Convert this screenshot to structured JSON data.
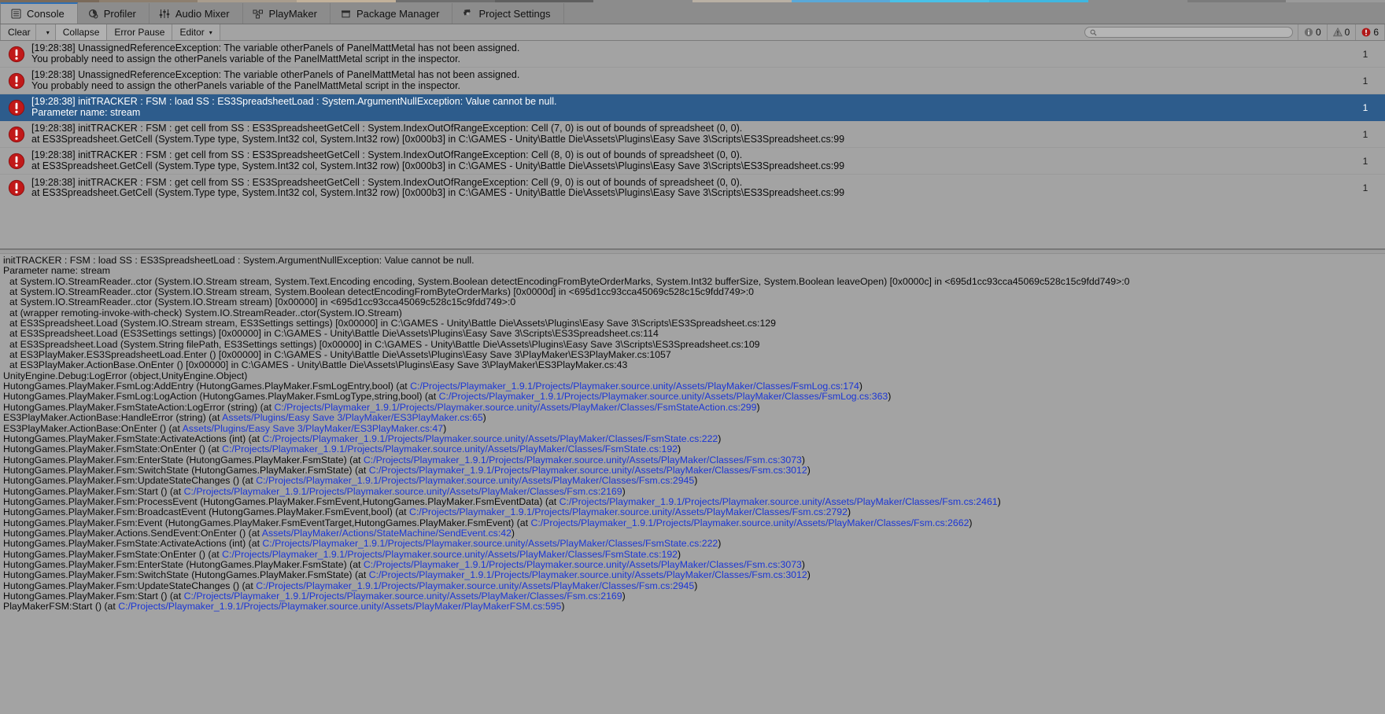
{
  "window": {
    "title": "Unity Console",
    "accent_blue": "#2d5c8c",
    "link_blue": "#1b36d6",
    "error_red": "#c11919",
    "panel_gray": "#a3a3a3"
  },
  "tabs": [
    {
      "label": "Console",
      "icon": "console-icon",
      "active": true
    },
    {
      "label": "Profiler",
      "icon": "profiler-icon",
      "active": false
    },
    {
      "label": "Audio Mixer",
      "icon": "audio-mixer-icon",
      "active": false
    },
    {
      "label": "PlayMaker",
      "icon": "playmaker-icon",
      "active": false
    },
    {
      "label": "Package Manager",
      "icon": "package-manager-icon",
      "active": false
    },
    {
      "label": "Project Settings",
      "icon": "gear-icon",
      "active": false
    }
  ],
  "toolbar": {
    "clear_label": "Clear",
    "clear_caret": "▾",
    "collapse_label": "Collapse",
    "error_pause_label": "Error Pause",
    "editor_label": "Editor",
    "editor_caret": "▾",
    "search_value": "",
    "search_placeholder": "",
    "search_icon": "search-icon",
    "counters": {
      "info_count": "0",
      "warning_count": "0",
      "error_count": "6"
    }
  },
  "log_entries": [
    {
      "icon": "error-icon",
      "line1": "[19:28:38] UnassignedReferenceException: The variable otherPanels of PanelMattMetal has not been assigned.",
      "line2": "You probably need to assign the otherPanels variable of the PanelMattMetal script in the inspector.",
      "count": "1",
      "selected": false
    },
    {
      "icon": "error-icon",
      "line1": "[19:28:38] UnassignedReferenceException: The variable otherPanels of PanelMattMetal has not been assigned.",
      "line2": "You probably need to assign the otherPanels variable of the PanelMattMetal script in the inspector.",
      "count": "1",
      "selected": false
    },
    {
      "icon": "error-icon",
      "line1": "[19:28:38] initTRACKER : FSM : load SS : ES3SpreadsheetLoad : System.ArgumentNullException: Value cannot be null.",
      "line2": "Parameter name: stream",
      "count": "1",
      "selected": true
    },
    {
      "icon": "error-icon",
      "line1": "[19:28:38] initTRACKER : FSM : get cell from SS : ES3SpreadsheetGetCell : System.IndexOutOfRangeException: Cell (7, 0) is out of bounds of spreadsheet (0, 0).",
      "line2": "  at ES3Spreadsheet.GetCell (System.Type type, System.Int32 col, System.Int32 row) [0x000b3] in C:\\GAMES - Unity\\Battle Die\\Assets\\Plugins\\Easy Save 3\\Scripts\\ES3Spreadsheet.cs:99",
      "count": "1",
      "selected": false
    },
    {
      "icon": "error-icon",
      "line1": "[19:28:38] initTRACKER : FSM : get cell from SS : ES3SpreadsheetGetCell : System.IndexOutOfRangeException: Cell (8, 0) is out of bounds of spreadsheet (0, 0).",
      "line2": "  at ES3Spreadsheet.GetCell (System.Type type, System.Int32 col, System.Int32 row) [0x000b3] in C:\\GAMES - Unity\\Battle Die\\Assets\\Plugins\\Easy Save 3\\Scripts\\ES3Spreadsheet.cs:99",
      "count": "1",
      "selected": false
    },
    {
      "icon": "error-icon",
      "line1": "[19:28:38] initTRACKER : FSM : get cell from SS : ES3SpreadsheetGetCell : System.IndexOutOfRangeException: Cell (9, 0) is out of bounds of spreadsheet (0, 0).",
      "line2": "  at ES3Spreadsheet.GetCell (System.Type type, System.Int32 col, System.Int32 row) [0x000b3] in C:\\GAMES - Unity\\Battle Die\\Assets\\Plugins\\Easy Save 3\\Scripts\\ES3Spreadsheet.cs:99",
      "count": "1",
      "selected": false
    }
  ],
  "detail": [
    {
      "indent": false,
      "pre": "initTRACKER : FSM : load SS : ES3SpreadsheetLoad : System.ArgumentNullException: Value cannot be null.",
      "link": "",
      "post": ""
    },
    {
      "indent": false,
      "pre": "Parameter name: stream",
      "link": "",
      "post": ""
    },
    {
      "indent": true,
      "pre": "at System.IO.StreamReader..ctor (System.IO.Stream stream, System.Text.Encoding encoding, System.Boolean detectEncodingFromByteOrderMarks, System.Int32 bufferSize, System.Boolean leaveOpen) [0x0000c] in <695d1cc93cca45069c528c15c9fdd749>:0",
      "link": "",
      "post": ""
    },
    {
      "indent": true,
      "pre": "at System.IO.StreamReader..ctor (System.IO.Stream stream, System.Boolean detectEncodingFromByteOrderMarks) [0x0000d] in <695d1cc93cca45069c528c15c9fdd749>:0",
      "link": "",
      "post": ""
    },
    {
      "indent": true,
      "pre": "at System.IO.StreamReader..ctor (System.IO.Stream stream) [0x00000] in <695d1cc93cca45069c528c15c9fdd749>:0",
      "link": "",
      "post": ""
    },
    {
      "indent": true,
      "pre": "at (wrapper remoting-invoke-with-check) System.IO.StreamReader..ctor(System.IO.Stream)",
      "link": "",
      "post": ""
    },
    {
      "indent": true,
      "pre": "at ES3Spreadsheet.Load (System.IO.Stream stream, ES3Settings settings) [0x00000] in C:\\GAMES - Unity\\Battle Die\\Assets\\Plugins\\Easy Save 3\\Scripts\\ES3Spreadsheet.cs:129",
      "link": "",
      "post": ""
    },
    {
      "indent": true,
      "pre": "at ES3Spreadsheet.Load (ES3Settings settings) [0x00000] in C:\\GAMES - Unity\\Battle Die\\Assets\\Plugins\\Easy Save 3\\Scripts\\ES3Spreadsheet.cs:114",
      "link": "",
      "post": ""
    },
    {
      "indent": true,
      "pre": "at ES3Spreadsheet.Load (System.String filePath, ES3Settings settings) [0x00000] in C:\\GAMES - Unity\\Battle Die\\Assets\\Plugins\\Easy Save 3\\Scripts\\ES3Spreadsheet.cs:109",
      "link": "",
      "post": ""
    },
    {
      "indent": true,
      "pre": "at ES3PlayMaker.ES3SpreadsheetLoad.Enter () [0x00000] in C:\\GAMES - Unity\\Battle Die\\Assets\\Plugins\\Easy Save 3\\PlayMaker\\ES3PlayMaker.cs:1057",
      "link": "",
      "post": ""
    },
    {
      "indent": true,
      "pre": "at ES3PlayMaker.ActionBase.OnEnter () [0x00000] in C:\\GAMES - Unity\\Battle Die\\Assets\\Plugins\\Easy Save 3\\PlayMaker\\ES3PlayMaker.cs:43",
      "link": "",
      "post": ""
    },
    {
      "indent": false,
      "pre": "UnityEngine.Debug:LogError (object,UnityEngine.Object)",
      "link": "",
      "post": ""
    },
    {
      "indent": false,
      "pre": "HutongGames.PlayMaker.FsmLog:AddEntry (HutongGames.PlayMaker.FsmLogEntry,bool) (at ",
      "link": "C:/Projects/Playmaker_1.9.1/Projects/Playmaker.source.unity/Assets/PlayMaker/Classes/FsmLog.cs:174",
      "post": ")"
    },
    {
      "indent": false,
      "pre": "HutongGames.PlayMaker.FsmLog:LogAction (HutongGames.PlayMaker.FsmLogType,string,bool) (at ",
      "link": "C:/Projects/Playmaker_1.9.1/Projects/Playmaker.source.unity/Assets/PlayMaker/Classes/FsmLog.cs:363",
      "post": ")"
    },
    {
      "indent": false,
      "pre": "HutongGames.PlayMaker.FsmStateAction:LogError (string) (at ",
      "link": "C:/Projects/Playmaker_1.9.1/Projects/Playmaker.source.unity/Assets/PlayMaker/Classes/FsmStateAction.cs:299",
      "post": ")"
    },
    {
      "indent": false,
      "pre": "ES3PlayMaker.ActionBase:HandleError (string) (at ",
      "link": "Assets/Plugins/Easy Save 3/PlayMaker/ES3PlayMaker.cs:65",
      "post": ")"
    },
    {
      "indent": false,
      "pre": "ES3PlayMaker.ActionBase:OnEnter () (at ",
      "link": "Assets/Plugins/Easy Save 3/PlayMaker/ES3PlayMaker.cs:47",
      "post": ")"
    },
    {
      "indent": false,
      "pre": "HutongGames.PlayMaker.FsmState:ActivateActions (int) (at ",
      "link": "C:/Projects/Playmaker_1.9.1/Projects/Playmaker.source.unity/Assets/PlayMaker/Classes/FsmState.cs:222",
      "post": ")"
    },
    {
      "indent": false,
      "pre": "HutongGames.PlayMaker.FsmState:OnEnter () (at ",
      "link": "C:/Projects/Playmaker_1.9.1/Projects/Playmaker.source.unity/Assets/PlayMaker/Classes/FsmState.cs:192",
      "post": ")"
    },
    {
      "indent": false,
      "pre": "HutongGames.PlayMaker.Fsm:EnterState (HutongGames.PlayMaker.FsmState) (at ",
      "link": "C:/Projects/Playmaker_1.9.1/Projects/Playmaker.source.unity/Assets/PlayMaker/Classes/Fsm.cs:3073",
      "post": ")"
    },
    {
      "indent": false,
      "pre": "HutongGames.PlayMaker.Fsm:SwitchState (HutongGames.PlayMaker.FsmState) (at ",
      "link": "C:/Projects/Playmaker_1.9.1/Projects/Playmaker.source.unity/Assets/PlayMaker/Classes/Fsm.cs:3012",
      "post": ")"
    },
    {
      "indent": false,
      "pre": "HutongGames.PlayMaker.Fsm:UpdateStateChanges () (at ",
      "link": "C:/Projects/Playmaker_1.9.1/Projects/Playmaker.source.unity/Assets/PlayMaker/Classes/Fsm.cs:2945",
      "post": ")"
    },
    {
      "indent": false,
      "pre": "HutongGames.PlayMaker.Fsm:Start () (at ",
      "link": "C:/Projects/Playmaker_1.9.1/Projects/Playmaker.source.unity/Assets/PlayMaker/Classes/Fsm.cs:2169",
      "post": ")"
    },
    {
      "indent": false,
      "pre": "HutongGames.PlayMaker.Fsm:ProcessEvent (HutongGames.PlayMaker.FsmEvent,HutongGames.PlayMaker.FsmEventData) (at ",
      "link": "C:/Projects/Playmaker_1.9.1/Projects/Playmaker.source.unity/Assets/PlayMaker/Classes/Fsm.cs:2461",
      "post": ")"
    },
    {
      "indent": false,
      "pre": "HutongGames.PlayMaker.Fsm:BroadcastEvent (HutongGames.PlayMaker.FsmEvent,bool) (at ",
      "link": "C:/Projects/Playmaker_1.9.1/Projects/Playmaker.source.unity/Assets/PlayMaker/Classes/Fsm.cs:2792",
      "post": ")"
    },
    {
      "indent": false,
      "pre": "HutongGames.PlayMaker.Fsm:Event (HutongGames.PlayMaker.FsmEventTarget,HutongGames.PlayMaker.FsmEvent) (at ",
      "link": "C:/Projects/Playmaker_1.9.1/Projects/Playmaker.source.unity/Assets/PlayMaker/Classes/Fsm.cs:2662",
      "post": ")"
    },
    {
      "indent": false,
      "pre": "HutongGames.PlayMaker.Actions.SendEvent:OnEnter () (at ",
      "link": "Assets/PlayMaker/Actions/StateMachine/SendEvent.cs:42",
      "post": ")"
    },
    {
      "indent": false,
      "pre": "HutongGames.PlayMaker.FsmState:ActivateActions (int) (at ",
      "link": "C:/Projects/Playmaker_1.9.1/Projects/Playmaker.source.unity/Assets/PlayMaker/Classes/FsmState.cs:222",
      "post": ")"
    },
    {
      "indent": false,
      "pre": "HutongGames.PlayMaker.FsmState:OnEnter () (at ",
      "link": "C:/Projects/Playmaker_1.9.1/Projects/Playmaker.source.unity/Assets/PlayMaker/Classes/FsmState.cs:192",
      "post": ")"
    },
    {
      "indent": false,
      "pre": "HutongGames.PlayMaker.Fsm:EnterState (HutongGames.PlayMaker.FsmState) (at ",
      "link": "C:/Projects/Playmaker_1.9.1/Projects/Playmaker.source.unity/Assets/PlayMaker/Classes/Fsm.cs:3073",
      "post": ")"
    },
    {
      "indent": false,
      "pre": "HutongGames.PlayMaker.Fsm:SwitchState (HutongGames.PlayMaker.FsmState) (at ",
      "link": "C:/Projects/Playmaker_1.9.1/Projects/Playmaker.source.unity/Assets/PlayMaker/Classes/Fsm.cs:3012",
      "post": ")"
    },
    {
      "indent": false,
      "pre": "HutongGames.PlayMaker.Fsm:UpdateStateChanges () (at ",
      "link": "C:/Projects/Playmaker_1.9.1/Projects/Playmaker.source.unity/Assets/PlayMaker/Classes/Fsm.cs:2945",
      "post": ")"
    },
    {
      "indent": false,
      "pre": "HutongGames.PlayMaker.Fsm:Start () (at ",
      "link": "C:/Projects/Playmaker_1.9.1/Projects/Playmaker.source.unity/Assets/PlayMaker/Classes/Fsm.cs:2169",
      "post": ")"
    },
    {
      "indent": false,
      "pre": "PlayMakerFSM:Start () (at ",
      "link": "C:/Projects/Playmaker_1.9.1/Projects/Playmaker.source.unity/Assets/PlayMaker/PlayMakerFSM.cs:595",
      "post": ")"
    }
  ]
}
